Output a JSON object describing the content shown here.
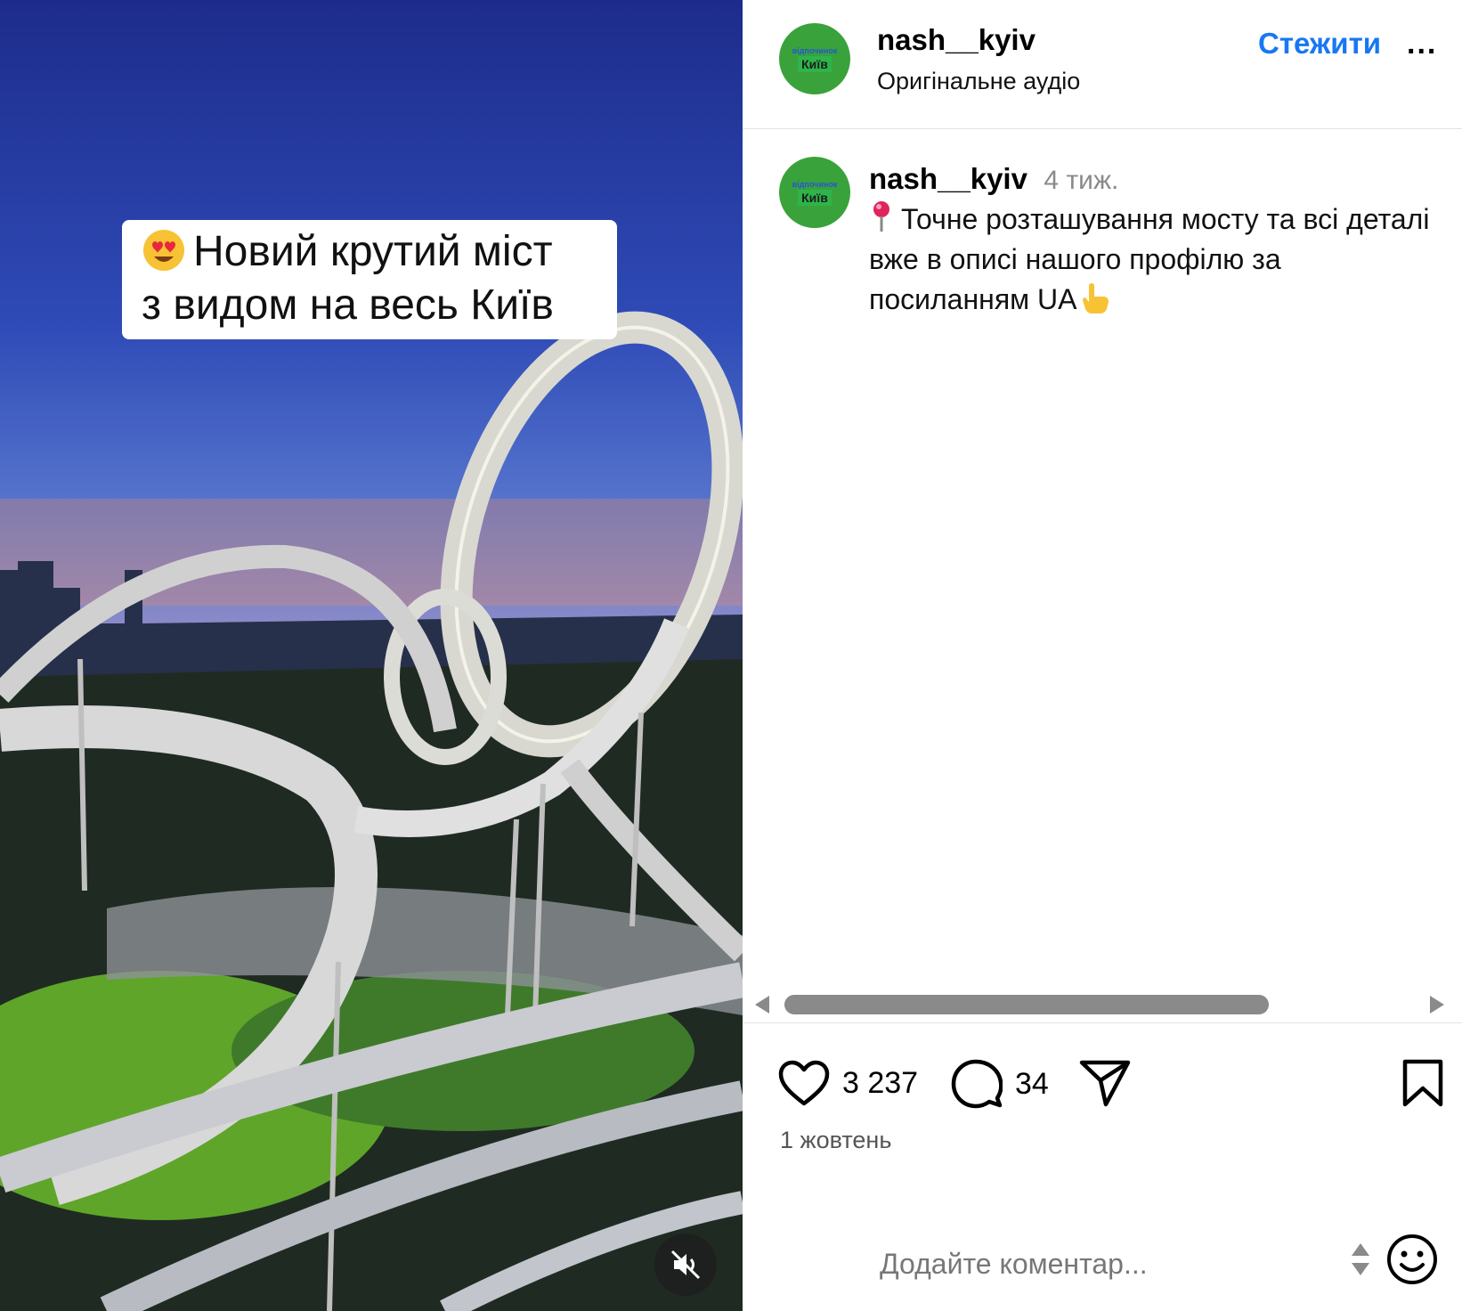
{
  "video": {
    "caption_line1": "Новий крутий міст",
    "caption_line2": "з видом на весь Київ",
    "caption_emoji": "smiling-face-with-heart-eyes-icon",
    "mute_icon": "speaker-muted-icon"
  },
  "header": {
    "avatar_top_text": "відпочинок",
    "avatar_main_text": "Київ",
    "username": "nash__kyiv",
    "subtitle": "Оригінальне аудіо",
    "follow_label": "Стежити",
    "more_label": "..."
  },
  "comment": {
    "username": "nash__kyiv",
    "time": "4 тиж.",
    "text": "Точне розташування мосту та всі деталі вже в описі нашого профілю за посиланням UA",
    "leading_icon": "round-pushpin-icon",
    "trailing_icon": "pointing-up-hand-icon"
  },
  "actions": {
    "likes": "3 237",
    "comments": "34",
    "date": "1 жовтень"
  },
  "add_comment": {
    "placeholder": "Додайте коментар..."
  },
  "colors": {
    "follow": "#1877f2",
    "avatar_bg": "#3aa23a",
    "scrollbar": "#8a8a8a"
  }
}
